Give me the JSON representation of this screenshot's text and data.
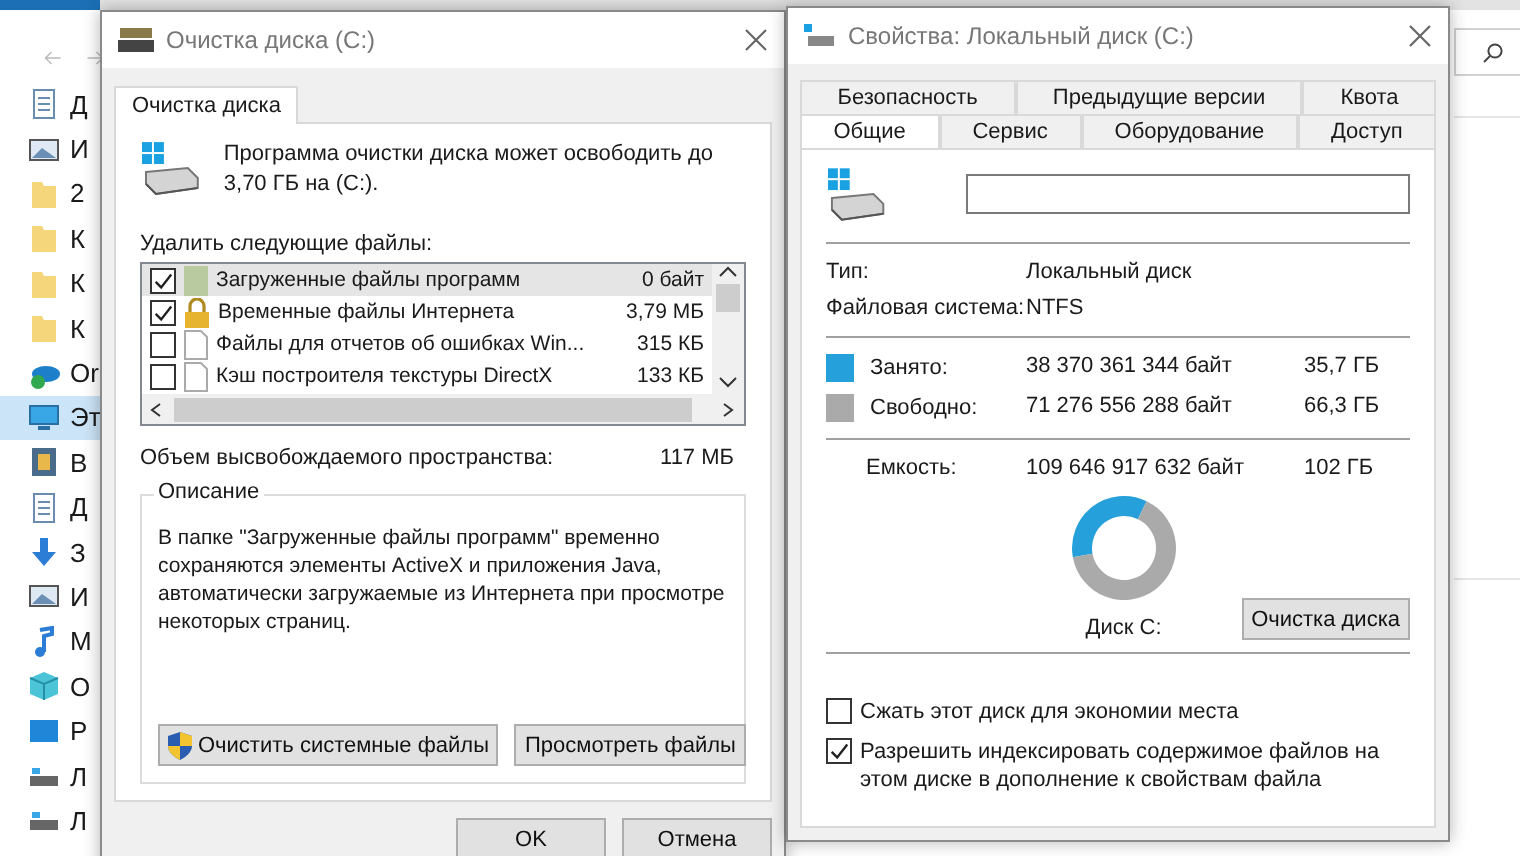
{
  "explorer": {
    "sidebar": {
      "items": [
        {
          "label": "Д",
          "kind": "document",
          "selected": false
        },
        {
          "label": "И",
          "kind": "picture",
          "selected": false
        },
        {
          "label": "2",
          "kind": "folder",
          "selected": false
        },
        {
          "label": "К",
          "kind": "folder",
          "selected": false
        },
        {
          "label": "К",
          "kind": "folder",
          "selected": false
        },
        {
          "label": "К",
          "kind": "folder",
          "selected": false
        },
        {
          "label": "Or",
          "kind": "cloud",
          "selected": false
        },
        {
          "label": "Эт",
          "kind": "computer",
          "selected": true
        },
        {
          "label": "В",
          "kind": "video",
          "selected": false
        },
        {
          "label": "Д",
          "kind": "document",
          "selected": false
        },
        {
          "label": "З",
          "kind": "download",
          "selected": false
        },
        {
          "label": "И",
          "kind": "picture",
          "selected": false
        },
        {
          "label": "М",
          "kind": "music",
          "selected": false
        },
        {
          "label": "О",
          "kind": "cube",
          "selected": false
        },
        {
          "label": "Р",
          "kind": "desktop",
          "selected": false
        },
        {
          "label": "Л",
          "kind": "drive",
          "selected": false
        },
        {
          "label": "Л",
          "kind": "drive",
          "selected": false
        }
      ]
    }
  },
  "cleanup_dialog": {
    "title": "Очистка диска  (C:)",
    "tab": "Очистка диска",
    "intro": "Программа очистки диска может освободить до 3,70 ГБ на  (C:).",
    "list_label": "Удалить следующие файлы:",
    "files": [
      {
        "name": "Загруженные файлы программ",
        "size": "0 байт",
        "checked": true,
        "selected": true,
        "kind": "package"
      },
      {
        "name": "Временные файлы Интернета",
        "size": "3,79 МБ",
        "checked": true,
        "selected": false,
        "kind": "lock"
      },
      {
        "name": "Файлы для отчетов об ошибках Win...",
        "size": "315 КБ",
        "checked": false,
        "selected": false,
        "kind": "page"
      },
      {
        "name": "Кэш построителя текстуры DirectX",
        "size": "133 КБ",
        "checked": false,
        "selected": false,
        "kind": "page"
      }
    ],
    "space_label": "Объем высвобождаемого пространства:",
    "space_value": "117 МБ",
    "description": {
      "legend": "Описание",
      "text": "В папке \"Загруженные файлы программ\" временно сохраняются элементы ActiveX и приложения Java, автоматически загружаемые из Интернета при просмотре некоторых страниц."
    },
    "buttons": [
      "Очистить системные файлы",
      "Просмотреть файлы"
    ],
    "footer_buttons": [
      "OK",
      "Отмена"
    ]
  },
  "properties_dialog": {
    "title": "Свойства: Локальный диск (C:)",
    "tabs_back": [
      {
        "label": "Безопасность",
        "selected": false
      },
      {
        "label": "Предыдущие версии",
        "selected": false
      },
      {
        "label": "Квота",
        "selected": false
      }
    ],
    "tabs_front": [
      {
        "label": "Общие",
        "selected": true
      },
      {
        "label": "Сервис",
        "selected": false
      },
      {
        "label": "Оборудование",
        "selected": false
      },
      {
        "label": "Доступ",
        "selected": false
      }
    ],
    "info": [
      {
        "label": "Тип:",
        "value": "Локальный диск"
      },
      {
        "label": "Файловая система:",
        "value": "NTFS"
      }
    ],
    "usage": [
      {
        "label": "Занято:",
        "bytes": "38 370 361 344 байт",
        "size": "35,7 ГБ",
        "color": "#26a0da"
      },
      {
        "label": "Свободно:",
        "bytes": "71 276 556 288 байт",
        "size": "66,3 ГБ",
        "color": "#aaaaaa"
      }
    ],
    "capacity": {
      "label": "Емкость:",
      "bytes": "109 646 917 632 байт",
      "size": "102 ГБ"
    },
    "chart_data": {
      "type": "donut",
      "values": [
        35,
        65
      ]
    },
    "disk_label": "Диск C:",
    "cleanup_button": "Очистка диска",
    "options": [
      {
        "label": "Сжать этот диск для экономии места",
        "checked": false
      },
      {
        "label": "Разрешить индексировать содержимое файлов на этом диске в дополнение к свойствам файла",
        "checked": true
      }
    ]
  }
}
